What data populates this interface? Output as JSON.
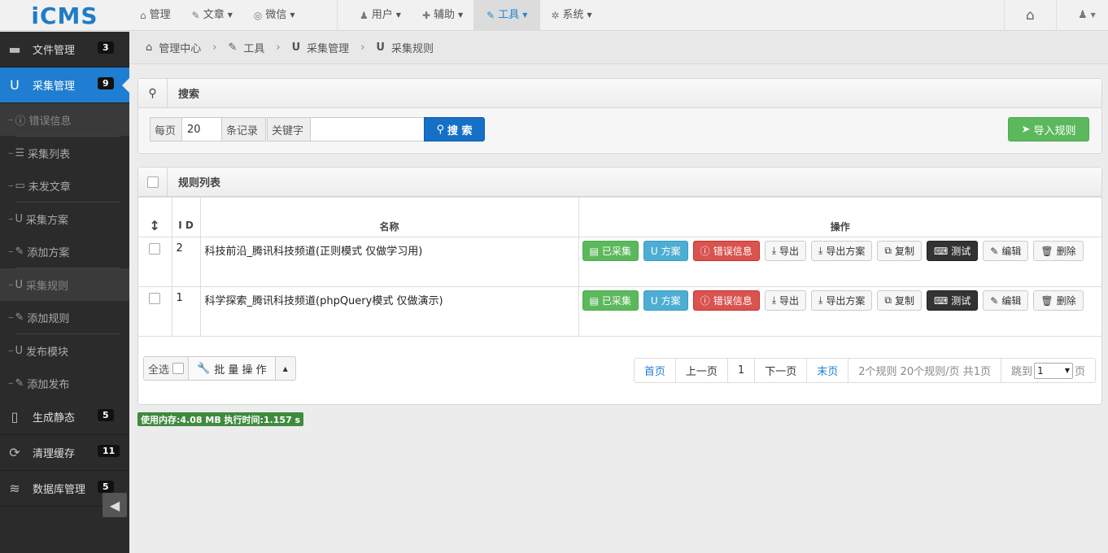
{
  "logo": "iCMS",
  "topnav": {
    "left": [
      {
        "icon": "home-icon",
        "glyph": "⌂",
        "label": "管理",
        "caret": false
      },
      {
        "icon": "edit-icon",
        "glyph": "✎",
        "label": "文章",
        "caret": true
      },
      {
        "icon": "wechat-icon",
        "glyph": "◎",
        "label": "微信",
        "caret": true
      }
    ],
    "right": [
      {
        "icon": "user-icon",
        "glyph": "♟",
        "label": "用户",
        "caret": true
      },
      {
        "icon": "wrench-icon",
        "glyph": "✚",
        "label": "辅助",
        "caret": true
      },
      {
        "icon": "gavel-icon",
        "glyph": "✎",
        "label": "工具",
        "caret": true,
        "active": true
      },
      {
        "icon": "gear-icon",
        "glyph": "✲",
        "label": "系统",
        "caret": true
      }
    ]
  },
  "sidebar": {
    "items": [
      {
        "label": "文件管理",
        "badge": "3"
      },
      {
        "label": "采集管理",
        "badge": "9"
      },
      {
        "label": "生成静态",
        "badge": "5"
      },
      {
        "label": "清理缓存",
        "badge": "11"
      },
      {
        "label": "数据库管理",
        "badge": "5"
      }
    ],
    "sub": [
      "错误信息",
      "采集列表",
      "未发文章",
      "采集方案",
      "添加方案",
      "采集规则",
      "添加规则",
      "发布模块",
      "添加发布"
    ]
  },
  "breadcrumb": [
    "管理中心",
    "工具",
    "采集管理",
    "采集规则"
  ],
  "search": {
    "title": "搜索",
    "per_page_label": "每页",
    "per_page_value": "20",
    "records_label": "条记录",
    "keyword_label": "关键字",
    "keyword_value": "",
    "search_button": "搜 索",
    "import_button": "导入规则"
  },
  "rules": {
    "title": "规则列表",
    "col_id": "I D",
    "col_name": "名称",
    "col_ops": "操作",
    "ops": {
      "collected": "已采集",
      "plan": "方案",
      "errors": "错误信息",
      "export": "导出",
      "export_plan": "导出方案",
      "copy": "复制",
      "test": "测试",
      "edit": "编辑",
      "delete": "删除"
    },
    "rows": [
      {
        "id": "2",
        "name": "科技前沿_腾讯科技频道(正则模式 仅做学习用)"
      },
      {
        "id": "1",
        "name": "科学探索_腾讯科技频道(phpQuery模式 仅做演示)"
      }
    ],
    "select_all": "全选",
    "batch": "批 量 操 作"
  },
  "pager": {
    "first": "首页",
    "prev": "上一页",
    "current": "1",
    "next": "下一页",
    "last": "末页",
    "summary": "2个规则 20个规则/页 共1页",
    "jump_label": "跳到",
    "jump_value": "1",
    "page_suffix": "页"
  },
  "status": "使用内存:4.08 MB 执行时间:1.157 s"
}
